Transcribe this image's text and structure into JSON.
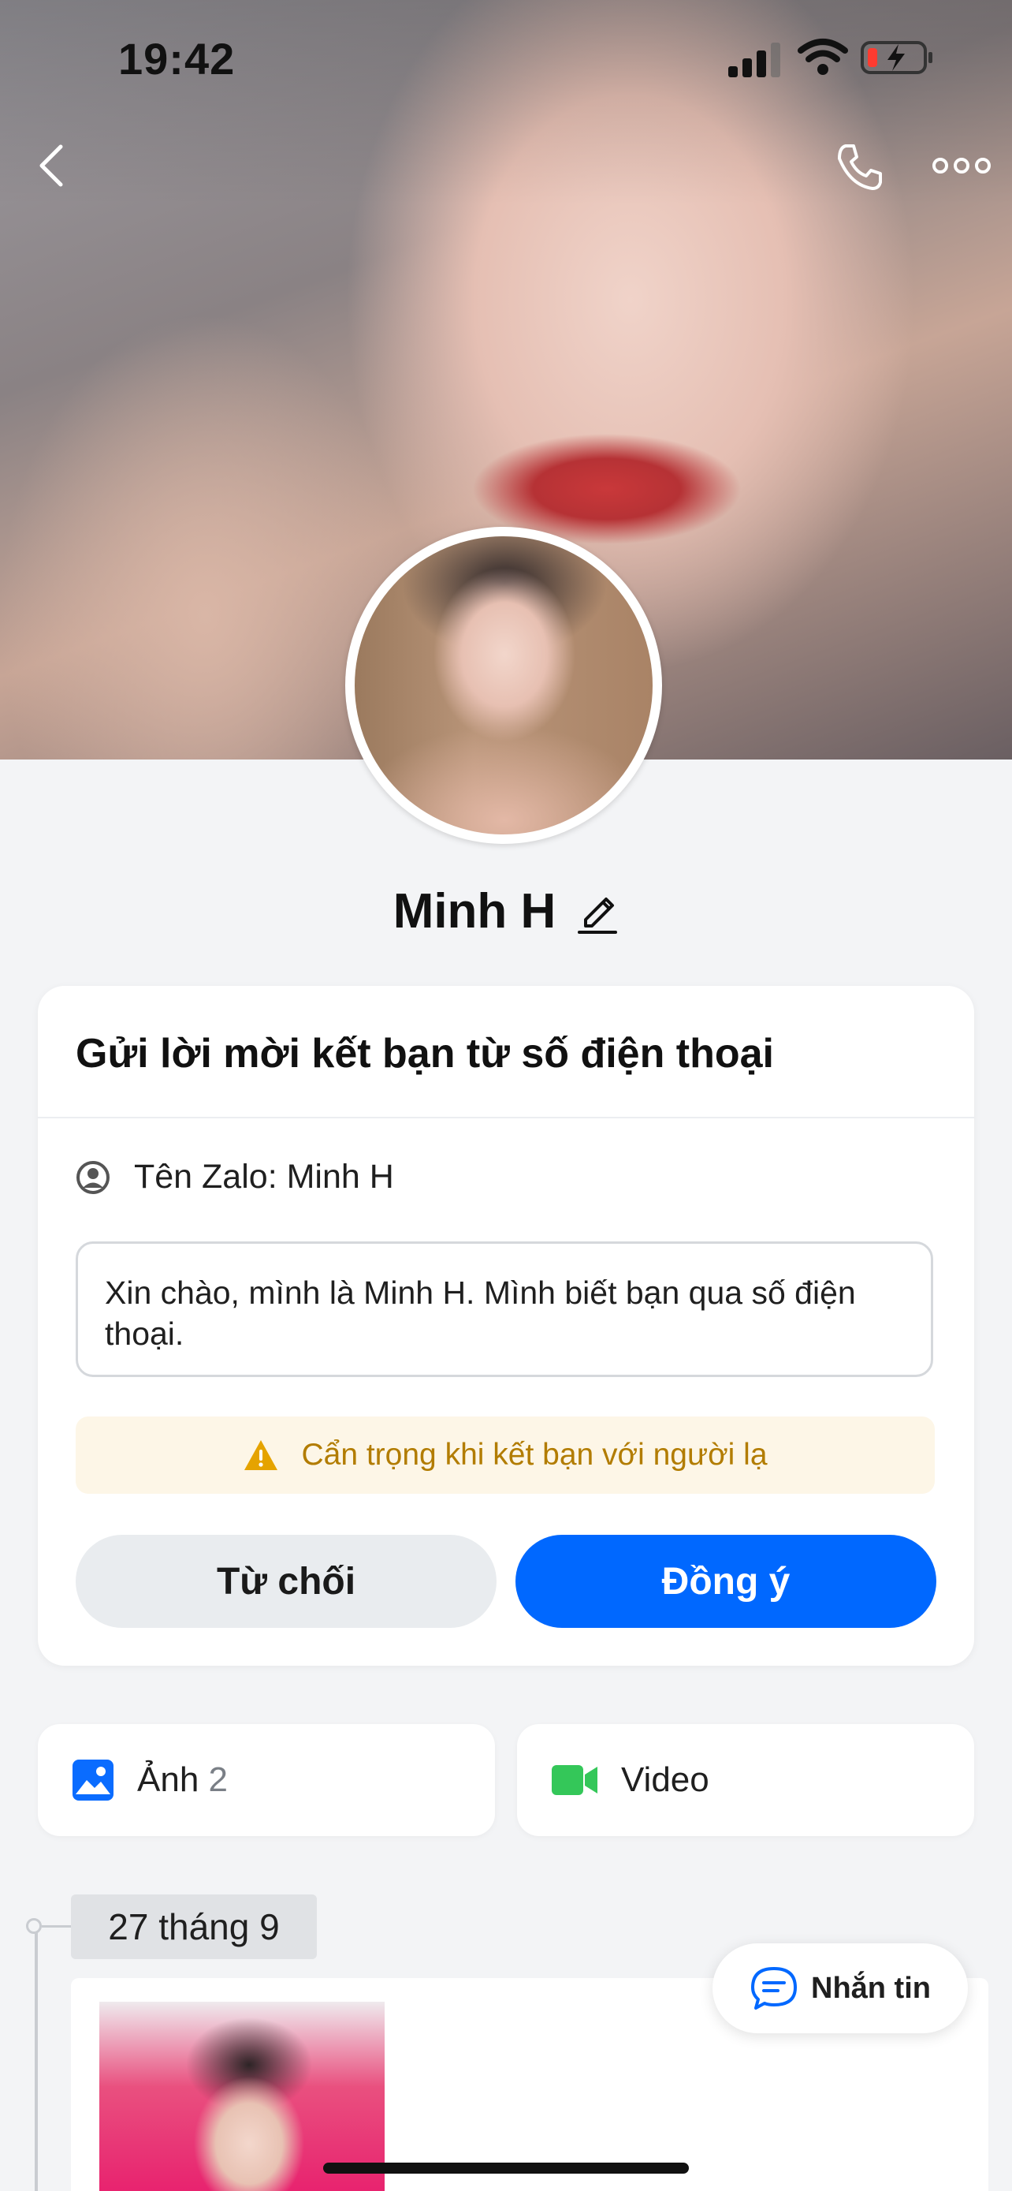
{
  "status_bar": {
    "time": "19:42"
  },
  "profile": {
    "name": "Minh H"
  },
  "friend_request": {
    "title": "Gửi lời mời kết bạn từ số điện thoại",
    "zalo_name": "Tên Zalo: Minh H",
    "message": "Xin chào, mình là Minh H. Mình biết bạn qua số điện thoại.",
    "warning": "Cẩn trọng khi kết bạn với người lạ",
    "decline_label": "Từ chối",
    "accept_label": "Đồng ý"
  },
  "media": {
    "photos_label": "Ảnh",
    "photos_count": "2",
    "video_label": "Video"
  },
  "timeline": {
    "date": "27 tháng 9"
  },
  "chat_button": {
    "label": "Nhắn tin"
  },
  "colors": {
    "accent": "#0068ff",
    "warning_text": "#b27c00",
    "warning_bg": "#fdf6e7",
    "video_icon": "#34c759"
  },
  "icons": [
    "back-icon",
    "phone-icon",
    "more-icon",
    "edit-icon",
    "user-circle-icon",
    "warning-icon",
    "image-icon",
    "video-icon",
    "chat-icon"
  ]
}
